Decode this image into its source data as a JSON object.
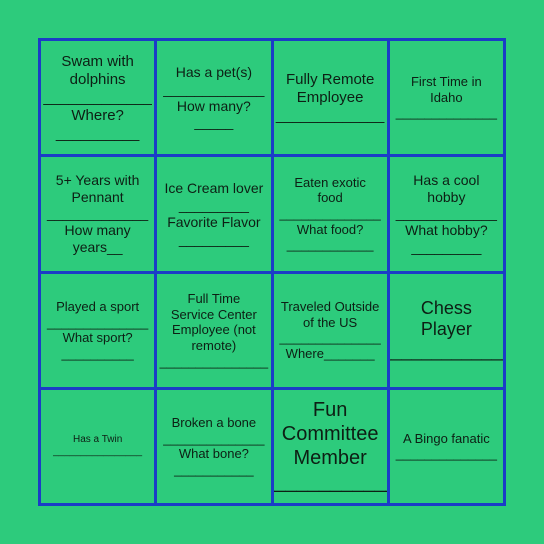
{
  "colors": {
    "background": "#2dcb7c",
    "grid_border": "#1b3cc7",
    "text": "#0d1f14"
  },
  "cells": [
    {
      "lines": [
        "Swam with",
        "dolphins",
        "_____________",
        "Where?",
        "__________"
      ],
      "size": "s-15"
    },
    {
      "lines": [
        "Has a pet(s)",
        "_____________",
        "How many?",
        "_____"
      ],
      "size": "s-14"
    },
    {
      "lines": [
        "Fully Remote",
        "Employee",
        "_____________"
      ],
      "size": "s-15"
    },
    {
      "lines": [
        "First Time in",
        "Idaho",
        "______________"
      ],
      "size": "s-13"
    },
    {
      "lines": [
        "5+ Years with",
        "Pennant",
        "_____________",
        "How many",
        "years__"
      ],
      "size": "s-14"
    },
    {
      "lines": [
        "Ice Cream lover",
        "_________",
        "Favorite Flavor",
        "_________"
      ],
      "size": "s-14"
    },
    {
      "lines": [
        "Eaten exotic",
        "food",
        "______________",
        "What food?",
        "____________"
      ],
      "size": "s-13"
    },
    {
      "lines": [
        "Has a cool",
        "hobby",
        "_____________",
        "What hobby?",
        "_________"
      ],
      "size": "s-14"
    },
    {
      "lines": [
        "Played a sport",
        "______________",
        "What sport?",
        "__________"
      ],
      "size": "s-13"
    },
    {
      "lines": [
        "Full Time",
        "Service Center",
        "Employee (not",
        "remote)",
        "_______________"
      ],
      "size": "s-13"
    },
    {
      "lines": [
        "Traveled Outside",
        "of the US",
        "______________",
        "Where_______"
      ],
      "size": "s-13"
    },
    {
      "lines": [
        "Chess",
        "Player",
        "_____________"
      ],
      "size": "s-18"
    },
    {
      "lines": [
        "Has a Twin",
        "________________"
      ],
      "size": "s-sm"
    },
    {
      "lines": [
        "Broken a bone",
        "______________",
        "What bone?",
        "___________"
      ],
      "size": "s-13"
    },
    {
      "lines": [
        "Fun",
        "Committee",
        "Member",
        "____________"
      ],
      "size": "s-20"
    },
    {
      "lines": [
        "A Bingo fanatic",
        "______________"
      ],
      "size": "s-13"
    }
  ]
}
